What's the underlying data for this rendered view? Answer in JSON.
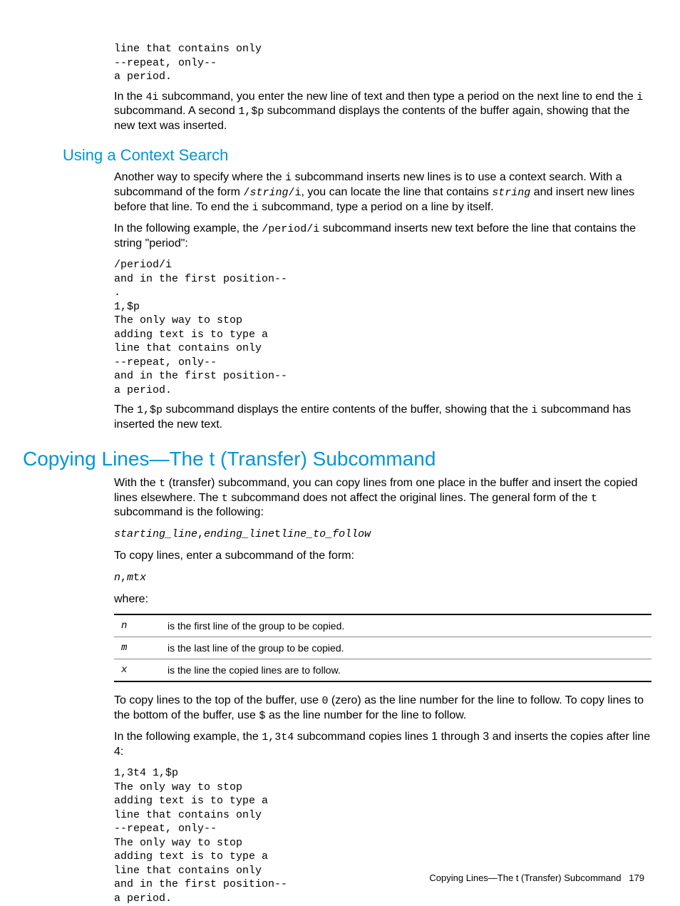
{
  "pre1": "line that contains only\n--repeat, only--\na period.",
  "para1_a": "In the ",
  "para1_b": "4i",
  "para1_c": " subcommand, you enter the new line of text and then type a period on the next line to end the ",
  "para1_d": "i",
  "para1_e": " subcommand. A second ",
  "para1_f": "1,$p",
  "para1_g": " subcommand displays the contents of the buffer again, showing that the new text was inserted.",
  "h2_context": "Using a Context Search",
  "para2_a": "Another way to specify where the ",
  "para2_b": "i",
  "para2_c": " subcommand inserts new lines is to use a context search. With a subcommand of the form ",
  "para2_d": "/",
  "para2_e": "string",
  "para2_f": "/i",
  "para2_g": ", you can locate the line that contains ",
  "para2_h": "string",
  "para2_i": " and insert new lines before that line. To end the ",
  "para2_j": "i",
  "para2_k": " subcommand, type a period on a line by itself.",
  "para3_a": "In the following example, the ",
  "para3_b": "/period/i",
  "para3_c": " subcommand inserts new text before the line that contains the string \"period\":",
  "pre2": "/period/i\nand in the first position--\n.\n1,$p\nThe only way to stop\nadding text is to type a\nline that contains only\n--repeat, only--\nand in the first position--\na period.",
  "para4_a": "The ",
  "para4_b": "1,$p",
  "para4_c": " subcommand displays the entire contents of the buffer, showing that the ",
  "para4_d": "i",
  "para4_e": " subcommand has inserted the new text.",
  "h1_copy": "Copying Lines—The t (Transfer) Subcommand",
  "para5_a": "With the ",
  "para5_b": "t",
  "para5_c": " (transfer) subcommand, you can copy lines from one place in the buffer and insert the copied lines elsewhere. The ",
  "para5_d": "t",
  "para5_e": " subcommand does not affect the original lines. The general form of the ",
  "para5_f": "t",
  "para5_g": " subcommand is the following:",
  "form1_a": "starting_line",
  "form1_b": ",",
  "form1_c": "ending_line",
  "form1_d": "t",
  "form1_e": "line_to_follow",
  "para6": "To copy lines, enter a subcommand of the form:",
  "form2_a": "n",
  "form2_b": ",",
  "form2_c": "m",
  "form2_d": "t",
  "form2_e": "x",
  "para7": "where:",
  "table": [
    {
      "sym": "n",
      "desc": "is the first line of the group to be copied."
    },
    {
      "sym": "m",
      "desc": "is the last line of the group to be copied."
    },
    {
      "sym": "x",
      "desc": "is the line the copied lines are to follow."
    }
  ],
  "para8_a": "To copy lines to the top of the buffer, use ",
  "para8_b": "0",
  "para8_c": " (zero) as the line number for the line to follow. To copy lines to the bottom of the buffer, use ",
  "para8_d": "$",
  "para8_e": " as the line number for the line to follow.",
  "para9_a": "In the following example, the ",
  "para9_b": "1,3t4",
  "para9_c": " subcommand copies lines 1 through 3 and inserts the copies after line 4:",
  "pre3": "1,3t4 1,$p\nThe only way to stop\nadding text is to type a\nline that contains only\n--repeat, only--\nThe only way to stop\nadding text is to type a\nline that contains only\nand in the first position--\na period.",
  "footer_title": "Copying Lines—The t (Transfer) Subcommand",
  "footer_page": "179"
}
